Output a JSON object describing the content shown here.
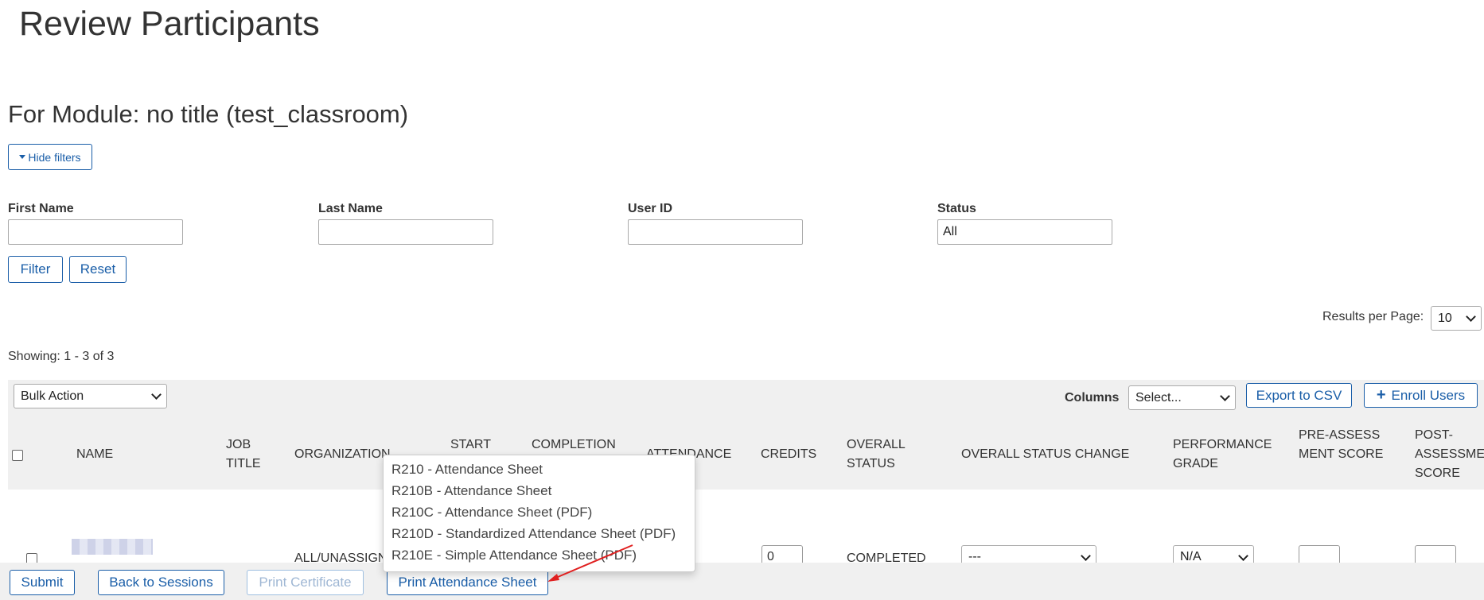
{
  "page": {
    "title": "Review Participants",
    "subtitle": "For Module: no title (test_classroom)"
  },
  "filters": {
    "toggle_label": "Hide filters",
    "first_name": {
      "label": "First Name",
      "value": ""
    },
    "last_name": {
      "label": "Last Name",
      "value": ""
    },
    "user_id": {
      "label": "User ID",
      "value": ""
    },
    "status": {
      "label": "Status",
      "value": "All"
    },
    "filter_button": "Filter",
    "reset_button": "Reset"
  },
  "results": {
    "per_page_label": "Results per Page:",
    "per_page_value": "10",
    "showing": "Showing: 1 - 3 of 3"
  },
  "toolbar": {
    "bulk_action": "Bulk Action",
    "columns_label": "Columns",
    "columns_select": "Select...",
    "export_csv": "Export to CSV",
    "enroll_users": "Enroll Users"
  },
  "table": {
    "headers": {
      "name": "NAME",
      "job_title": "JOB TITLE",
      "organization": "ORGANIZATION",
      "start": "START",
      "completion": "COMPLETION",
      "attendance": "ATTENDANCE",
      "credits": "CREDITS",
      "overall_status": "OVERALL STATUS",
      "overall_status_change": "OVERALL STATUS CHANGE",
      "performance_grade": "PERFORMANCE GRADE",
      "pre_assessment_score": "PRE-ASSESSMENT SCORE",
      "post_assessment_score": "POST-ASSESSMENT SCORE"
    },
    "rows": [
      {
        "organization": "ALL/UNASSIGNED",
        "credits": "0",
        "overall_status": "COMPLETED",
        "status_change": "---",
        "performance_grade": "N/A"
      }
    ]
  },
  "dropdown": {
    "items": [
      "R210 - Attendance Sheet",
      "R210B - Attendance Sheet",
      "R210C - Attendance Sheet (PDF)",
      "R210D - Standardized Attendance Sheet (PDF)",
      "R210E - Simple Attendance Sheet (PDF)"
    ]
  },
  "footer": {
    "submit": "Submit",
    "back": "Back to Sessions",
    "print_certificate": "Print Certificate",
    "print_attendance": "Print Attendance Sheet"
  },
  "colors": {
    "accent": "#1a5ea8",
    "annotation_arrow": "#e02020",
    "panel_bg": "#f0f0f0"
  }
}
